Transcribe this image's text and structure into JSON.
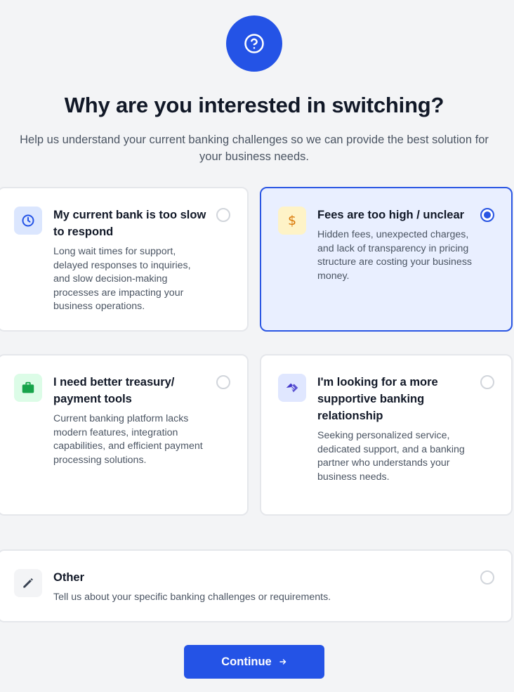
{
  "header": {
    "icon": "question-circle-icon",
    "title": "Why are you interested in switching?",
    "subtitle": "Help us understand your current banking challenges so we can provide the best solution for your business needs."
  },
  "options": [
    {
      "title": "My current bank is too slow to respond",
      "description": "Long wait times for support, delayed responses to inquiries, and slow decision-making processes are impacting your business operations.",
      "icon": "clock-icon",
      "selected": false
    },
    {
      "title": "Fees are too high / unclear",
      "description": "Hidden fees, unexpected charges, and lack of transparency in pricing structure are costing your business money.",
      "icon": "dollar-icon",
      "selected": true
    },
    {
      "title": "I need better treasury/ payment tools",
      "description": "Current banking platform lacks modern features, integration capabilities, and efficient payment processing solutions.",
      "icon": "briefcase-icon",
      "selected": false
    },
    {
      "title": "I'm looking for a more supportive banking relationship",
      "description": "Seeking personalized service, dedicated support, and a banking partner who understands your business needs.",
      "icon": "handshake-icon",
      "selected": false
    },
    {
      "title": "Other",
      "description": "Tell us about your specific banking challenges or requirements.",
      "icon": "pencil-icon",
      "selected": false
    }
  ],
  "continue": {
    "label": "Continue",
    "icon": "arrow-right-icon"
  },
  "colors": {
    "accent": "#2453e6",
    "selected_bg": "#e9efff",
    "clock_bg": "#dbe6fe",
    "dollar_bg": "#fef3c7",
    "briefcase_bg": "#dcfce7",
    "handshake_bg": "#e0e7ff",
    "pencil_bg": "#f3f4f6"
  }
}
